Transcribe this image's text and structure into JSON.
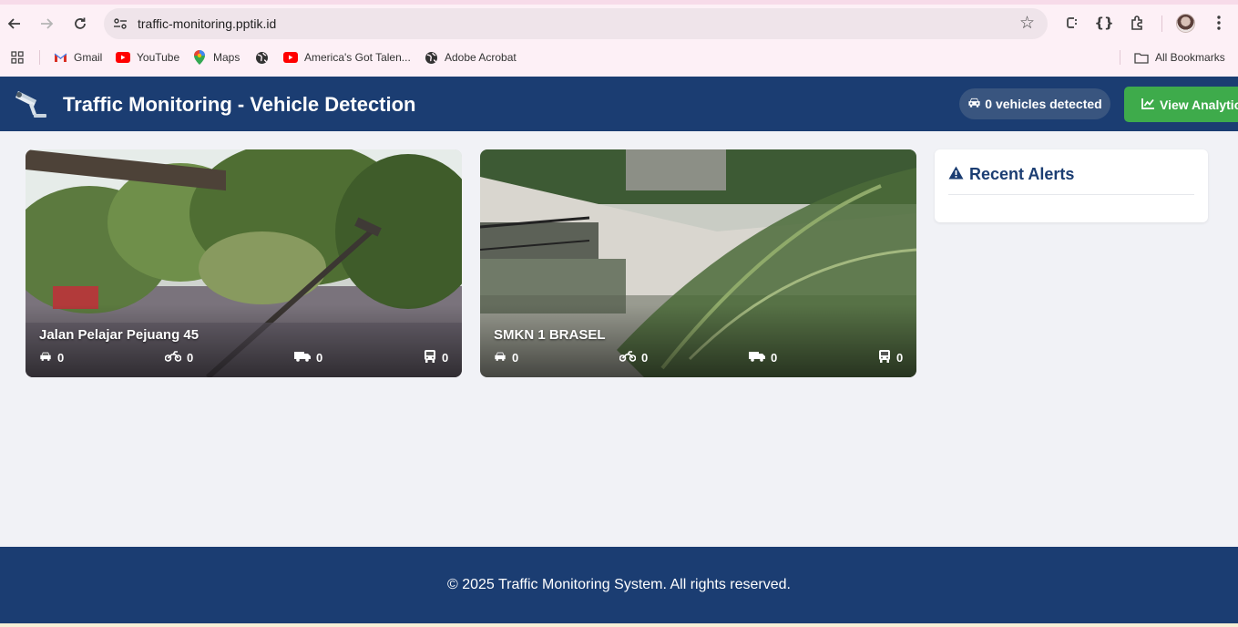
{
  "browser": {
    "url": "traffic-monitoring.pptik.id",
    "bookmarks": [
      {
        "label": "Gmail",
        "icon": "gmail-icon"
      },
      {
        "label": "YouTube",
        "icon": "youtube-icon"
      },
      {
        "label": "Maps",
        "icon": "maps-icon"
      },
      {
        "label": "",
        "icon": "globe-icon"
      },
      {
        "label": "America's Got Talen...",
        "icon": "youtube-icon"
      },
      {
        "label": "Adobe Acrobat",
        "icon": "globe-icon"
      }
    ],
    "all_bookmarks_label": "All Bookmarks"
  },
  "header": {
    "title": "Traffic Monitoring - Vehicle Detection",
    "vehicle_count_label": "0 vehicles detected",
    "analytics_label": "View Analytics"
  },
  "cameras": [
    {
      "name": "Jalan Pelajar Pejuang 45",
      "stats": {
        "car": "0",
        "motorcycle": "0",
        "truck": "0",
        "bus": "0"
      }
    },
    {
      "name": "SMKN 1 BRASEL",
      "stats": {
        "car": "0",
        "motorcycle": "0",
        "truck": "0",
        "bus": "0"
      }
    }
  ],
  "alerts": {
    "title": "Recent Alerts"
  },
  "footer": {
    "text": "© 2025 Traffic Monitoring System. All rights reserved."
  },
  "colors": {
    "header_bg": "#1b3d72",
    "accent_green": "#3eab4b",
    "page_bg": "#f1f2f6"
  }
}
